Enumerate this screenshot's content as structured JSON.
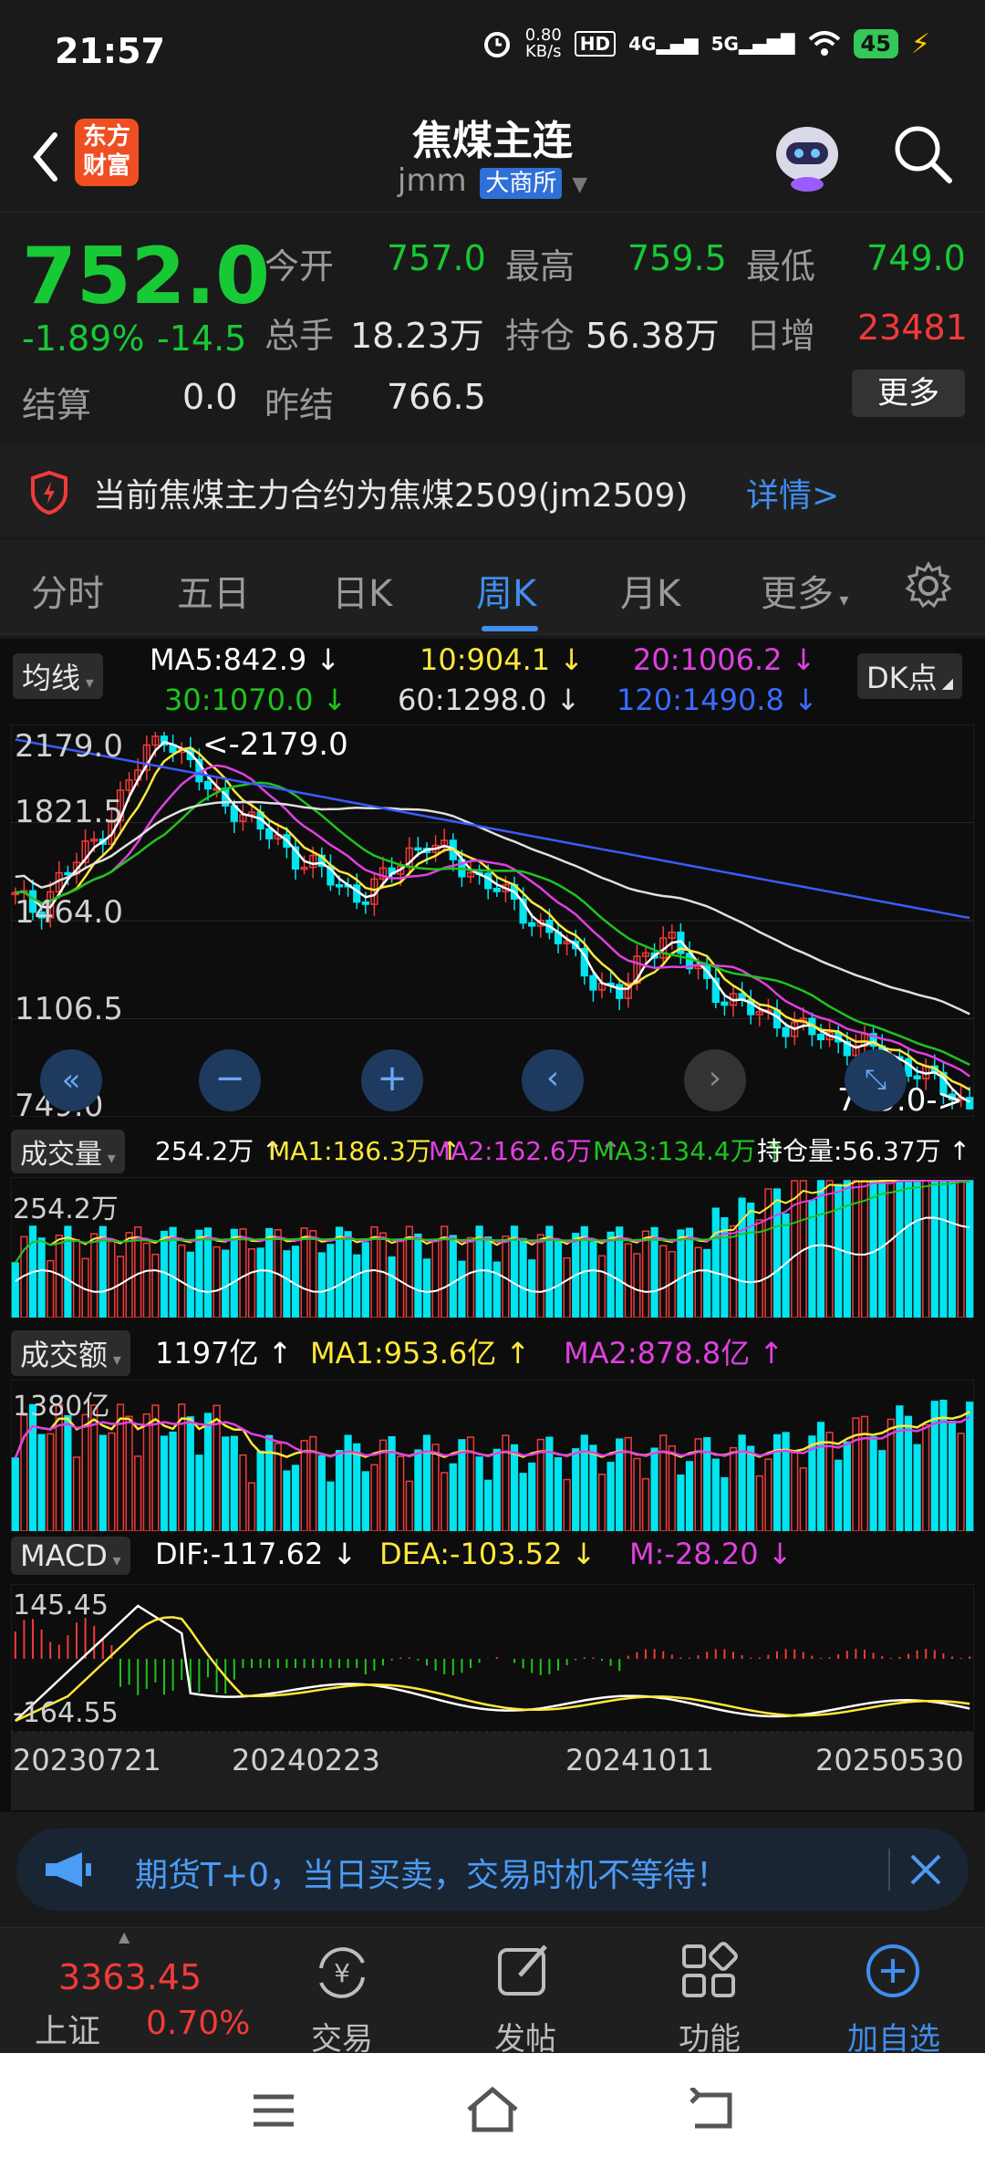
{
  "status_bar": {
    "time": "21:57",
    "net_speed_value": "0.80",
    "net_speed_unit": "KB/s",
    "hd": "HD",
    "sig4g": "4G",
    "sig5g": "5G",
    "battery": "45"
  },
  "header": {
    "logo_line1": "东方",
    "logo_line2": "财富",
    "title": "焦煤主连",
    "code": "jmm",
    "exchange": "大商所"
  },
  "quote": {
    "price": "752.0",
    "change_pct": "-1.89%",
    "change": "-14.5",
    "open_label": "今开",
    "open": "757.0",
    "high_label": "最高",
    "high": "759.5",
    "low_label": "最低",
    "low": "749.0",
    "volume_label": "总手",
    "volume": "18.23万",
    "oi_label": "持仓",
    "oi": "56.38万",
    "daily_inc_label": "日增",
    "daily_inc": "23481",
    "settle_label": "结算",
    "settle": "0.0",
    "prev_settle_label": "昨结",
    "prev_settle": "766.5",
    "more_button": "更多"
  },
  "notice": {
    "text": "当前焦煤主力合约为焦煤2509(jm2509)",
    "detail": "详情>"
  },
  "tabs": {
    "items": [
      "分时",
      "五日",
      "日K",
      "周K",
      "月K",
      "更多"
    ],
    "active": "周K"
  },
  "chart": {
    "ma_select": "均线",
    "dk_button": "DK点",
    "ma5": "MA5:842.9 ↓",
    "ma10": "10:904.1 ↓",
    "ma20": "20:1006.2 ↓",
    "ma30": "30:1070.0 ↓",
    "ma60": "60:1298.0 ↓",
    "ma120": "120:1490.8 ↓",
    "y_ticks": [
      "2179.0",
      "1821.5",
      "1464.0",
      "1106.5",
      "749.0"
    ],
    "high_marker": "<-2179.0",
    "low_marker": "749.0->",
    "vol_select": "成交量",
    "vol_value": "254.2万 ↑",
    "vol_ma1": "MA1:186.3万 ↑",
    "vol_ma2": "MA2:162.6万 ↑",
    "vol_ma3": "MA3:134.4万 ↑",
    "vol_oi": "持仓量:56.37万 ↑",
    "vol_tick": "254.2万",
    "amt_select": "成交额",
    "amt_value": "1197亿 ↑",
    "amt_ma1": "MA1:953.6亿 ↑",
    "amt_ma2": "MA2:878.8亿 ↑",
    "amt_tick": "1380亿",
    "macd_select": "MACD",
    "dif": "DIF:-117.62 ↓",
    "dea": "DEA:-103.52 ↓",
    "m": "M:-28.20 ↓",
    "macd_top": "145.45",
    "macd_bottom": "-164.55",
    "dates": [
      "20230721",
      "20240223",
      "20241011",
      "20250530"
    ],
    "colors": {
      "up": "#f23a3a",
      "down": "#00e5f0",
      "ma5": "#ffffff",
      "ma10": "#ffe83a",
      "ma20": "#e040e0",
      "ma30": "#1ec41e",
      "ma60": "#e0e0e0",
      "ma120": "#3a5cff"
    }
  },
  "chart_data": {
    "type": "candlestick",
    "title": "焦煤主连 周K",
    "ylim": [
      749.0,
      2179.0
    ],
    "x_labels": [
      "20230721",
      "20240223",
      "20241011",
      "20250530"
    ],
    "close_approx": [
      1550,
      1500,
      1620,
      1700,
      1800,
      1950,
      2100,
      2179,
      2050,
      1950,
      1900,
      1820,
      1780,
      1700,
      1650,
      1600,
      1550,
      1620,
      1720,
      1760,
      1700,
      1650,
      1600,
      1520,
      1460,
      1400,
      1300,
      1220,
      1180,
      1340,
      1420,
      1300,
      1220,
      1160,
      1120,
      1090,
      1060,
      1030,
      1010,
      990,
      960,
      920,
      870,
      820,
      752
    ]
  },
  "promo": {
    "text": "期货T+0，当日买卖，交易时机不等待！"
  },
  "bottom_nav": {
    "index_value": "3363.45",
    "index_name": "上证",
    "index_change": "0.70%",
    "items": [
      "交易",
      "发帖",
      "功能",
      "加自选"
    ]
  }
}
